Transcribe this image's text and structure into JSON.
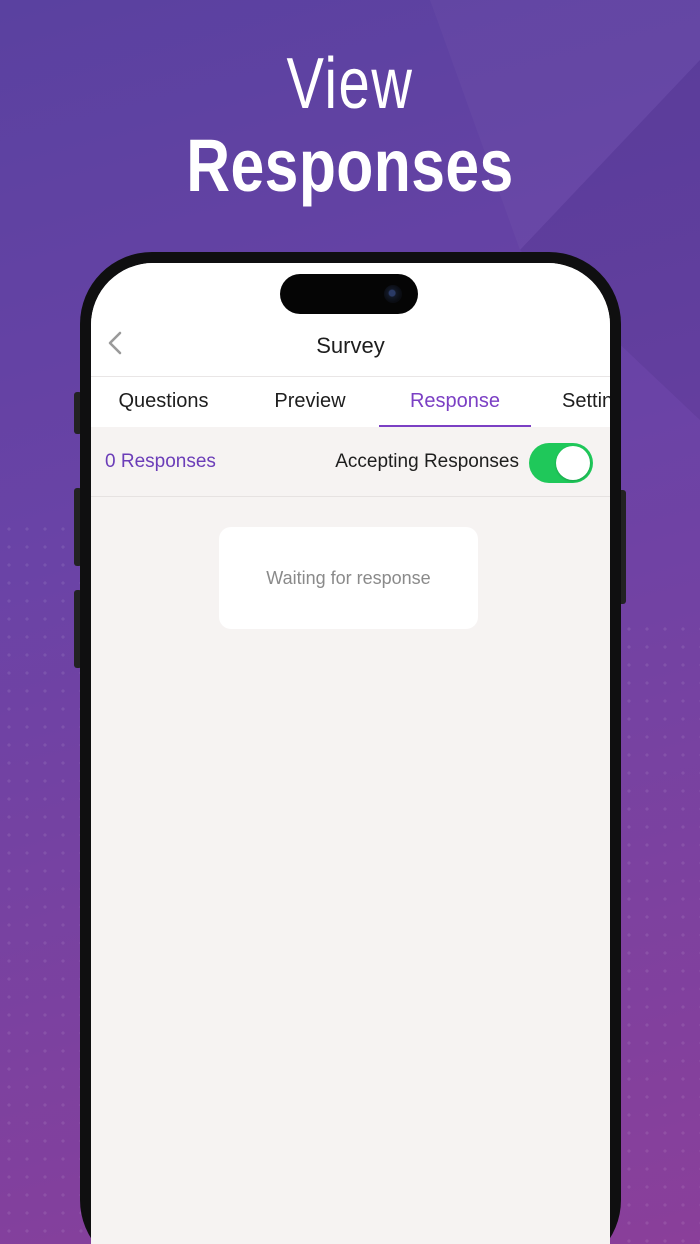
{
  "headline": {
    "line1": "View",
    "line2": "Responses"
  },
  "nav": {
    "title": "Survey",
    "back_icon": "chevron-left-icon"
  },
  "tabs": [
    {
      "label": "Questions",
      "active": false
    },
    {
      "label": "Preview",
      "active": false
    },
    {
      "label": "Response",
      "active": true
    },
    {
      "label": "Settings",
      "active": false
    }
  ],
  "status": {
    "responses_count": "0 Responses",
    "accepting_label": "Accepting Responses",
    "accepting_on": true
  },
  "empty_state": {
    "message": "Waiting for response"
  },
  "colors": {
    "accent": "#7b3fc4",
    "toggle_on": "#1fc85a",
    "background_top": "#5a41a0",
    "background_bottom": "#8a3f9a"
  }
}
